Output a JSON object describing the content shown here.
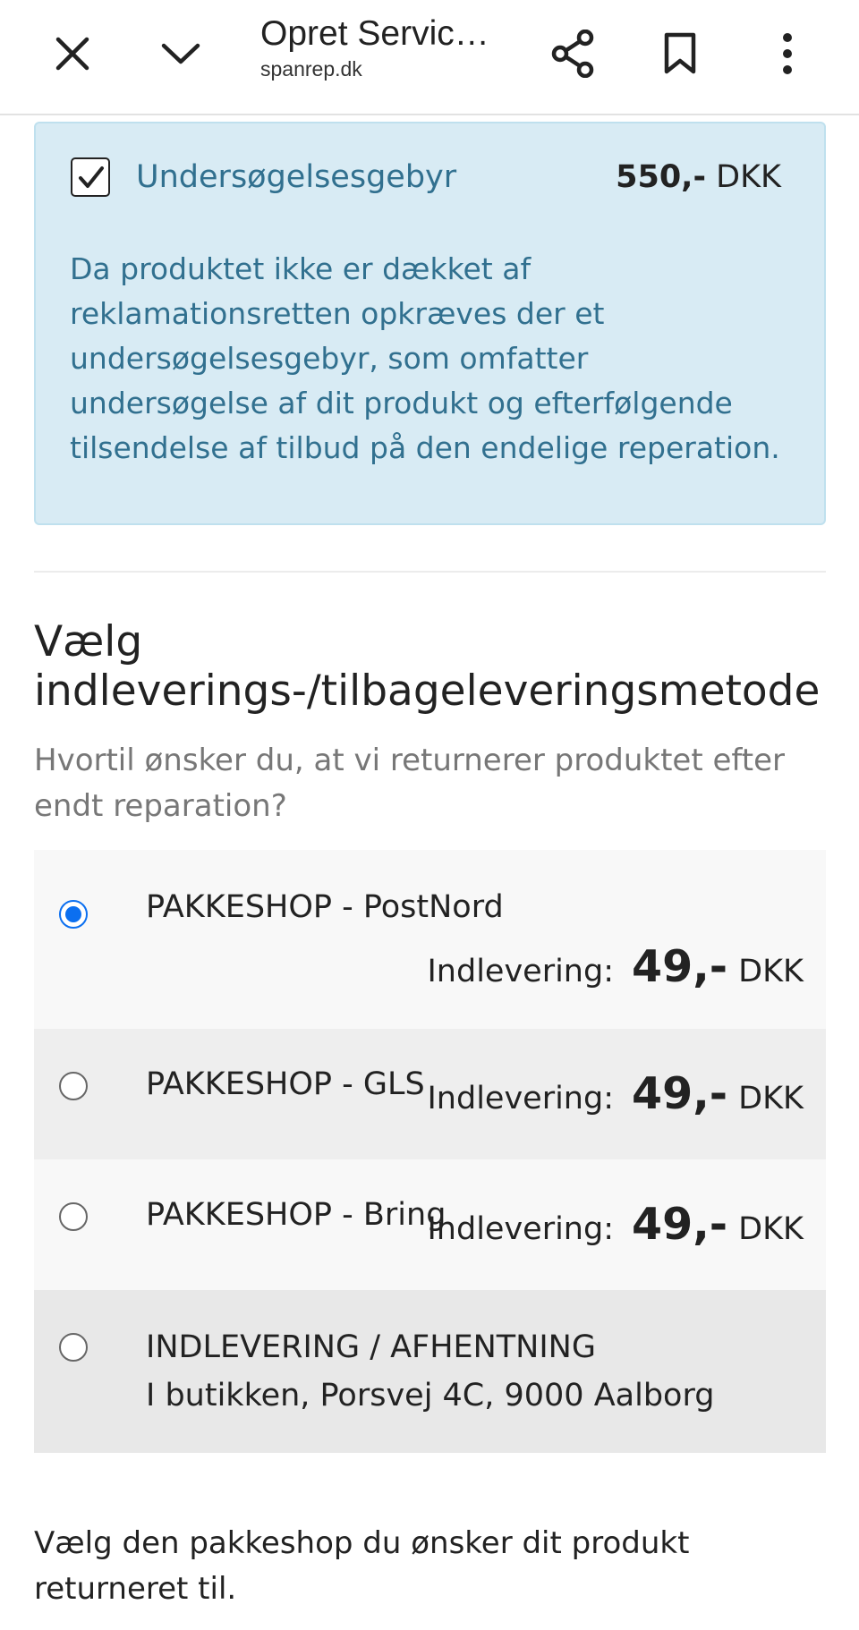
{
  "topbar": {
    "title": "Opret Servic…",
    "url": "spanrep.dk",
    "icons": [
      "close-icon",
      "chevron-down-icon",
      "share-icon",
      "bookmark-icon",
      "more-vert-icon"
    ]
  },
  "fee": {
    "label": "Undersøgelsesgebyr",
    "checked": true,
    "price_amount": "550,-",
    "price_currency": "DKK",
    "description": "Da produktet ikke er dækket af reklamationsretten opkræves der et undersøgelsesgebyr, som omfatter undersøgelse af dit produkt og efterfølgende tilsendelse af tilbud på den endelige reperation."
  },
  "delivery": {
    "title_line1": "Vælg",
    "title_line2": "indleverings-/tilbageleveringsmetode",
    "subtitle": "Hvortil ønsker du, at vi returnerer produktet efter endt reparation?",
    "options": [
      {
        "label": "PAKKESHOP - PostNord",
        "price_label": "Indlevering:",
        "amount": "49,-",
        "currency": "DKK",
        "selected": true
      },
      {
        "label": "PAKKESHOP - GLS",
        "price_label": "Indlevering:",
        "amount": "49,-",
        "currency": "DKK",
        "selected": false
      },
      {
        "label": "PAKKESHOP - Bring",
        "price_label": "Indlevering:",
        "amount": "49,-",
        "currency": "DKK",
        "selected": false
      },
      {
        "label": "INDLEVERING / AFHENTNING",
        "sub": "I butikken, Porsvej 4C, 9000 Aalborg",
        "selected": false
      }
    ],
    "footer": "Vælg den pakkeshop du ønsker dit produkt returneret til."
  },
  "colors": {
    "info_bg": "#d8ebf4",
    "info_text": "#31708f",
    "radio_selected": "#0b6ff0"
  }
}
